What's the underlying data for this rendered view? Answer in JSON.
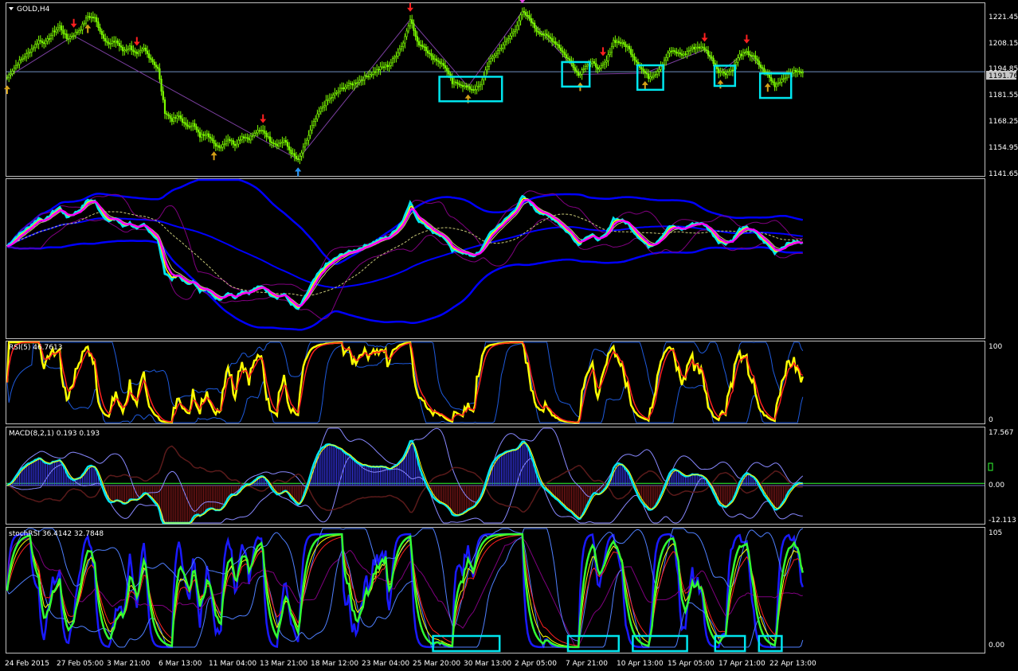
{
  "window": {
    "symbol_label": "GOLD,H4"
  },
  "colors": {
    "background": "#000000",
    "frame": "#c0c0c0",
    "candle": "#7cfc00",
    "hline": "#6f8fbf",
    "box": "#00e5ee",
    "arrow_up": "#d4a017",
    "arrow_down": "#ff2020",
    "arrow_top": "#e040e0",
    "arrow_bottom": "#1e90ff",
    "zigzag": "#7b3fa0",
    "cyan": "#00e5ee",
    "magenta": "#ff00ff",
    "yellow": "#ffff00",
    "blue": "#0000ff",
    "green": "#32ff32",
    "red": "#ff2020",
    "purple": "#800080",
    "khaki": "#c8c878"
  },
  "price": {
    "ticks": [
      "1221.45",
      "1208.15",
      "1194.85",
      "1181.55",
      "1168.25",
      "1154.95",
      "1141.65"
    ],
    "current": "1191.76"
  },
  "rsi": {
    "title": "RSI(5) 46.7613",
    "top": "100",
    "bottom": "0"
  },
  "macd": {
    "title": "MACD(8,2,1) 0.193 0.193",
    "top": "17.567",
    "zero": "0.00",
    "bottom": "-12.113"
  },
  "stochrsi": {
    "title": "stochRSI 36.4142 32.7848",
    "top": "105",
    "bottom": "0.00"
  },
  "time_axis": [
    "24 Feb 2015",
    "27 Feb 05:00",
    "3 Mar 21:00",
    "6 Mar 13:00",
    "11 Mar 04:00",
    "13 Mar 21:00",
    "18 Mar 12:00",
    "23 Mar 04:00",
    "25 Mar 20:00",
    "30 Mar 13:00",
    "2 Apr 05:00",
    "7 Apr 21:00",
    "10 Apr 13:00",
    "15 Apr 05:00",
    "17 Apr 21:00",
    "22 Apr 13:00"
  ],
  "chart_data": {
    "type": "line",
    "symbol": "GOLD",
    "timeframe": "H4",
    "close": [
      [
        0,
        1189
      ],
      [
        6,
        1196
      ],
      [
        12,
        1201
      ],
      [
        18,
        1207
      ],
      [
        22,
        1206
      ],
      [
        26,
        1211
      ],
      [
        30,
        1214
      ],
      [
        34,
        1208
      ],
      [
        38,
        1210
      ],
      [
        42,
        1213
      ],
      [
        46,
        1219
      ],
      [
        50,
        1218
      ],
      [
        54,
        1210
      ],
      [
        58,
        1205
      ],
      [
        62,
        1207
      ],
      [
        66,
        1202
      ],
      [
        70,
        1204
      ],
      [
        74,
        1200
      ],
      [
        78,
        1203
      ],
      [
        82,
        1198
      ],
      [
        86,
        1193
      ],
      [
        90,
        1172
      ],
      [
        94,
        1168
      ],
      [
        98,
        1170
      ],
      [
        102,
        1165
      ],
      [
        106,
        1166
      ],
      [
        110,
        1160
      ],
      [
        114,
        1162
      ],
      [
        118,
        1156
      ],
      [
        122,
        1155
      ],
      [
        126,
        1159
      ],
      [
        130,
        1156
      ],
      [
        134,
        1160
      ],
      [
        138,
        1159
      ],
      [
        142,
        1162
      ],
      [
        146,
        1163
      ],
      [
        150,
        1158
      ],
      [
        154,
        1156
      ],
      [
        158,
        1158
      ],
      [
        162,
        1152
      ],
      [
        166,
        1148
      ],
      [
        170,
        1156
      ],
      [
        174,
        1165
      ],
      [
        178,
        1172
      ],
      [
        182,
        1177
      ],
      [
        186,
        1180
      ],
      [
        190,
        1183
      ],
      [
        194,
        1185
      ],
      [
        198,
        1186
      ],
      [
        202,
        1188
      ],
      [
        206,
        1190
      ],
      [
        210,
        1192
      ],
      [
        214,
        1194
      ],
      [
        218,
        1195
      ],
      [
        222,
        1200
      ],
      [
        226,
        1206
      ],
      [
        230,
        1218
      ],
      [
        234,
        1206
      ],
      [
        238,
        1204
      ],
      [
        242,
        1199
      ],
      [
        246,
        1197
      ],
      [
        250,
        1194
      ],
      [
        254,
        1186
      ],
      [
        258,
        1186
      ],
      [
        262,
        1184
      ],
      [
        266,
        1183
      ],
      [
        270,
        1185
      ],
      [
        274,
        1195
      ],
      [
        278,
        1200
      ],
      [
        282,
        1204
      ],
      [
        286,
        1208
      ],
      [
        290,
        1213
      ],
      [
        294,
        1221
      ],
      [
        298,
        1218
      ],
      [
        302,
        1212
      ],
      [
        306,
        1210
      ],
      [
        310,
        1208
      ],
      [
        314,
        1205
      ],
      [
        318,
        1200
      ],
      [
        322,
        1196
      ],
      [
        326,
        1190
      ],
      [
        330,
        1195
      ],
      [
        334,
        1196
      ],
      [
        338,
        1193
      ],
      [
        342,
        1197
      ],
      [
        346,
        1207
      ],
      [
        350,
        1206
      ],
      [
        354,
        1204
      ],
      [
        358,
        1198
      ],
      [
        362,
        1193
      ],
      [
        366,
        1189
      ],
      [
        370,
        1191
      ],
      [
        374,
        1196
      ],
      [
        378,
        1202
      ],
      [
        382,
        1201
      ],
      [
        386,
        1200
      ],
      [
        390,
        1203
      ],
      [
        394,
        1204
      ],
      [
        398,
        1203
      ],
      [
        402,
        1198
      ],
      [
        406,
        1192
      ],
      [
        410,
        1191
      ],
      [
        414,
        1193
      ],
      [
        418,
        1200
      ],
      [
        422,
        1201
      ],
      [
        426,
        1199
      ],
      [
        430,
        1194
      ],
      [
        434,
        1190
      ],
      [
        438,
        1185
      ],
      [
        442,
        1188
      ],
      [
        446,
        1191
      ],
      [
        450,
        1192
      ],
      [
        454,
        1191
      ]
    ],
    "buy_signals": [
      0,
      46,
      118,
      166,
      263,
      327,
      364,
      407,
      434
    ],
    "sell_signals": [
      38,
      74,
      146,
      230,
      340,
      398,
      422
    ],
    "top_signal": 294,
    "bottom_signal": 166,
    "highlight_ranges": [
      [
        248,
        281
      ],
      [
        318,
        331
      ],
      [
        361,
        373
      ],
      [
        405,
        414
      ],
      [
        431,
        446
      ]
    ],
    "stoch_highlight_ranges": [
      [
        243,
        281
      ],
      [
        320,
        349
      ],
      [
        357,
        388
      ],
      [
        404,
        421
      ],
      [
        429,
        442
      ]
    ],
    "rsi_title": "RSI(5) 46.7613",
    "macd_title": "MACD(8,2,1) 0.193 0.193",
    "stoch_title": "stochRSI 36.4142 32.7848"
  }
}
